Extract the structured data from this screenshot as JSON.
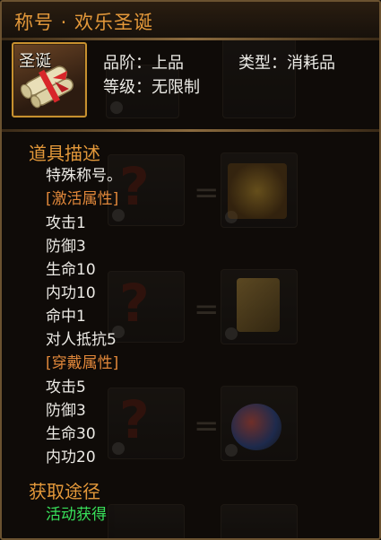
{
  "title": "称号 · 欢乐圣诞",
  "item": {
    "icon_label": "圣诞",
    "grade_label": "品阶：",
    "grade_value": "上品",
    "type_label": "类型：",
    "type_value": "消耗品",
    "level_label": "等级：",
    "level_value": "无限制"
  },
  "description": {
    "header": "道具描述",
    "summary": "特殊称号。",
    "activate_header": "[激活属性]",
    "activate_stats": [
      "攻击1",
      "防御3",
      "生命10",
      "内功10",
      "命中1",
      "对人抵抗5"
    ],
    "wear_header": "[穿戴属性]",
    "wear_stats": [
      "攻击5",
      "防御3",
      "生命30",
      "内功20"
    ]
  },
  "source": {
    "header": "获取途径",
    "value": "活动获得"
  },
  "colors": {
    "title": "#e3983a",
    "section_header": "#e3983a",
    "bracket_header": "#e0873a",
    "stat_text": "#eceae5",
    "source_text": "#38e05a",
    "icon_border": "#c7902f"
  }
}
